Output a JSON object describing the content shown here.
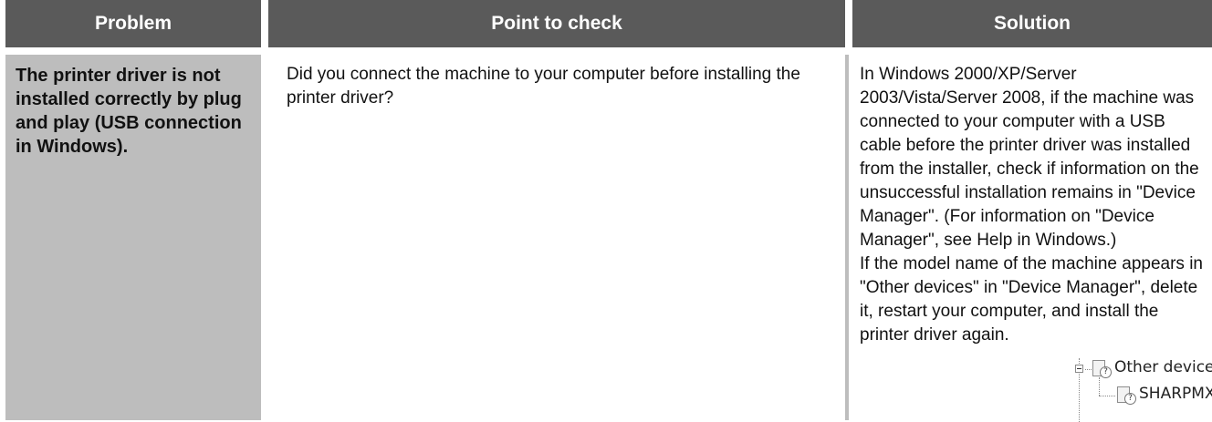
{
  "headers": {
    "problem": "Problem",
    "point_to_check": "Point to check",
    "solution": "Solution"
  },
  "row": {
    "problem": "The printer driver is not installed correctly by plug and play (USB connection in Windows).",
    "point_to_check": "Did you connect the machine to your computer before installing the printer driver?",
    "solution_p1": "In Windows 2000/XP/Server 2003/Vista/Server 2008, if the machine was connected to your computer with a USB cable before the printer driver was installed from the installer, check if information on the unsuccessful installation remains in \"Device Manager\". (For information on \"Device Manager\", see Help in Windows.)",
    "solution_p2": "If the model name of the machine appears in \"Other devices\" in \"Device Manager\", delete it, restart your computer, and install the printer driver again."
  },
  "device_tree": {
    "parent_label": "Other devices",
    "child_label": "SHARPMX-xxxx",
    "icon": "unknown-device-icon"
  },
  "colors": {
    "header_bg": "#5a5a5a",
    "header_text": "#ffffff",
    "problem_bg": "#bdbdbd"
  }
}
